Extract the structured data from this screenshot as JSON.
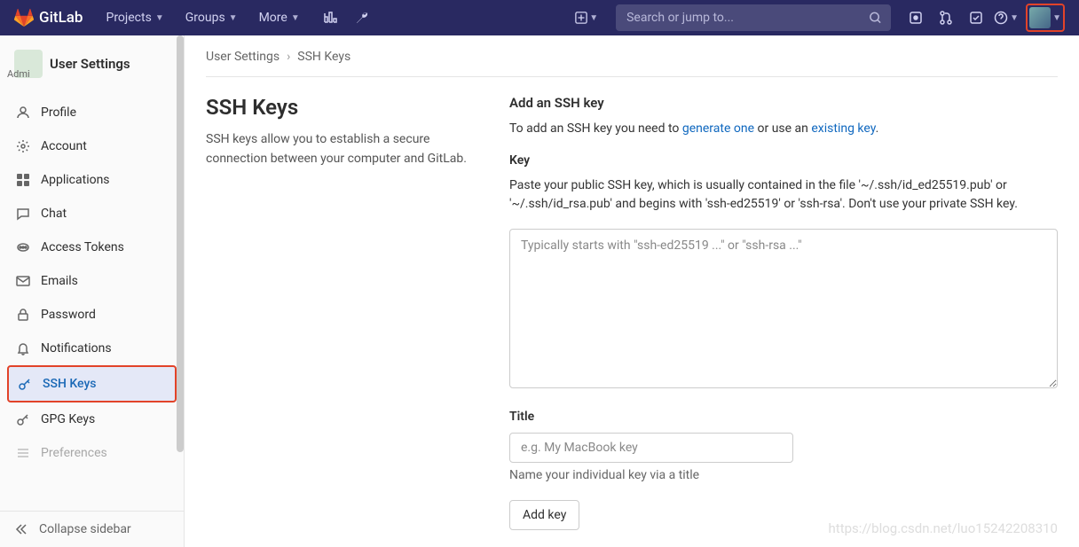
{
  "brand": "GitLab",
  "topnav": {
    "projects": "Projects",
    "groups": "Groups",
    "more": "More"
  },
  "search": {
    "placeholder": "Search or jump to..."
  },
  "sidebar": {
    "title": "User Settings",
    "items": [
      {
        "label": "Profile"
      },
      {
        "label": "Account"
      },
      {
        "label": "Applications"
      },
      {
        "label": "Chat"
      },
      {
        "label": "Access Tokens"
      },
      {
        "label": "Emails"
      },
      {
        "label": "Password"
      },
      {
        "label": "Notifications"
      },
      {
        "label": "SSH Keys"
      },
      {
        "label": "GPG Keys"
      },
      {
        "label": "Preferences"
      }
    ],
    "collapse": "Collapse sidebar"
  },
  "breadcrumb": {
    "a": "User Settings",
    "b": "SSH Keys"
  },
  "page": {
    "heading": "SSH Keys",
    "intro": "SSH keys allow you to establish a secure connection between your computer and GitLab.",
    "addTitle": "Add an SSH key",
    "addText1": "To add an SSH key you need to ",
    "linkGenerate": "generate one",
    "addText2": " or use an ",
    "linkExisting": "existing key",
    "addText3": ".",
    "keyLabel": "Key",
    "keyHelp": "Paste your public SSH key, which is usually contained in the file '~/.ssh/id_ed25519.pub' or '~/.ssh/id_rsa.pub' and begins with 'ssh-ed25519' or 'ssh-rsa'. Don't use your private SSH key.",
    "keyPlaceholder": "Typically starts with \"ssh-ed25519 ...\" or \"ssh-rsa ...\"",
    "titleLabel": "Title",
    "titlePlaceholder": "e.g. My MacBook key",
    "titleHint": "Name your individual key via a title",
    "submit": "Add key"
  },
  "watermark": "https://blog.csdn.net/luo15242208310"
}
